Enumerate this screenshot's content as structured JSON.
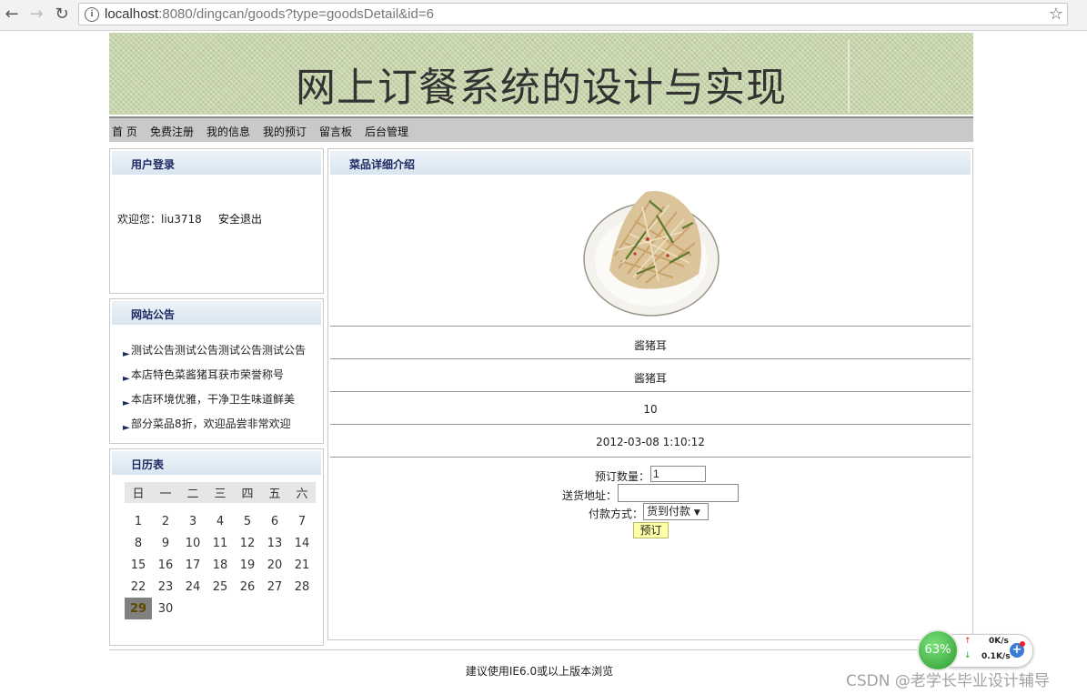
{
  "browser": {
    "url_host": "localhost",
    "url_rest": ":8080/dingcan/goods?type=goodsDetail&id=6"
  },
  "banner": {
    "title": "网上订餐系统的设计与实现"
  },
  "menu": [
    "首 页",
    "免费注册",
    "我的信息",
    "我的预订",
    "留言板",
    "后台管理"
  ],
  "login_box": {
    "title": "用户登录",
    "welcome": "欢迎您：liu3718",
    "logout": "安全退出"
  },
  "notice_box": {
    "title": "网站公告",
    "items": [
      "测试公告测试公告测试公告测试公告",
      "本店特色菜酱猪耳获市荣誉称号",
      "本店环境优雅，干净卫生味道鲜美",
      "部分菜品8折，欢迎品尝非常欢迎"
    ]
  },
  "calendar": {
    "title": "日历表",
    "weekdays": [
      "日",
      "一",
      "二",
      "三",
      "四",
      "五",
      "六"
    ],
    "weeks": [
      [
        "1",
        "2",
        "3",
        "4",
        "5",
        "6",
        "7"
      ],
      [
        "8",
        "9",
        "10",
        "11",
        "12",
        "13",
        "14"
      ],
      [
        "15",
        "16",
        "17",
        "18",
        "19",
        "20",
        "21"
      ],
      [
        "22",
        "23",
        "24",
        "25",
        "26",
        "27",
        "28"
      ],
      [
        "29",
        "30",
        "",
        "",
        "",
        "",
        ""
      ]
    ],
    "today": "29"
  },
  "detail": {
    "title": "菜品详细介绍",
    "name": "酱猪耳",
    "description": "酱猪耳",
    "price": "10",
    "date": "2012-03-08 1:10:12"
  },
  "order_form": {
    "qty_label": "预订数量：",
    "qty_value": "1",
    "addr_label": "送货地址：",
    "addr_value": "",
    "pay_label": "付款方式：",
    "pay_value": "货到付款",
    "submit": "预订"
  },
  "footer": {
    "text": "建议使用IE6.0或以上版本浏览"
  },
  "speed_widget": {
    "percent": "63%",
    "up": "0K/s",
    "down": "0.1K/s"
  },
  "watermark": "CSDN @老学长毕业设计辅导"
}
